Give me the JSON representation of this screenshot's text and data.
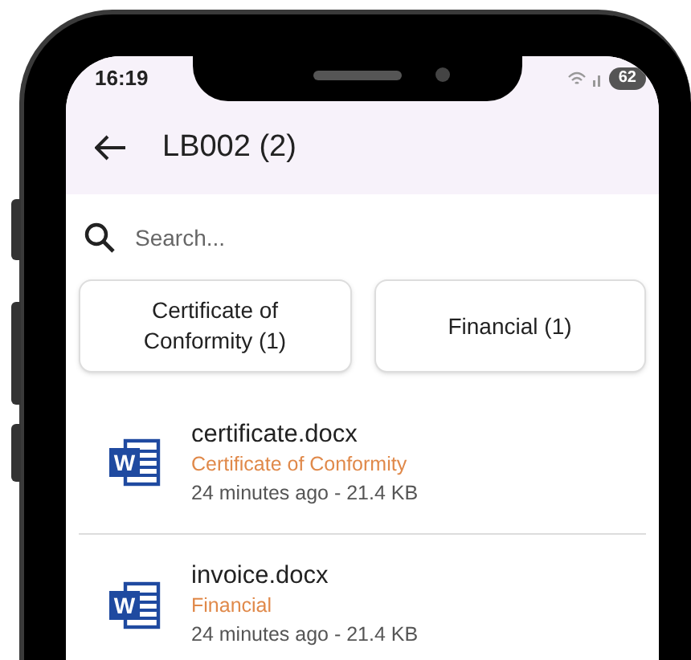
{
  "status_bar": {
    "time": "16:19",
    "battery": "62"
  },
  "header": {
    "title": "LB002 (2)"
  },
  "search": {
    "placeholder": "Search..."
  },
  "filters": [
    {
      "label": "Certificate of Conformity (1)"
    },
    {
      "label": "Financial (1)"
    }
  ],
  "files": [
    {
      "name": "certificate.docx",
      "category": "Certificate of Conformity",
      "meta": "24 minutes ago - 21.4 KB",
      "icon_letter": "W"
    },
    {
      "name": "invoice.docx",
      "category": "Financial",
      "meta": "24 minutes ago - 21.4 KB",
      "icon_letter": "W"
    }
  ]
}
